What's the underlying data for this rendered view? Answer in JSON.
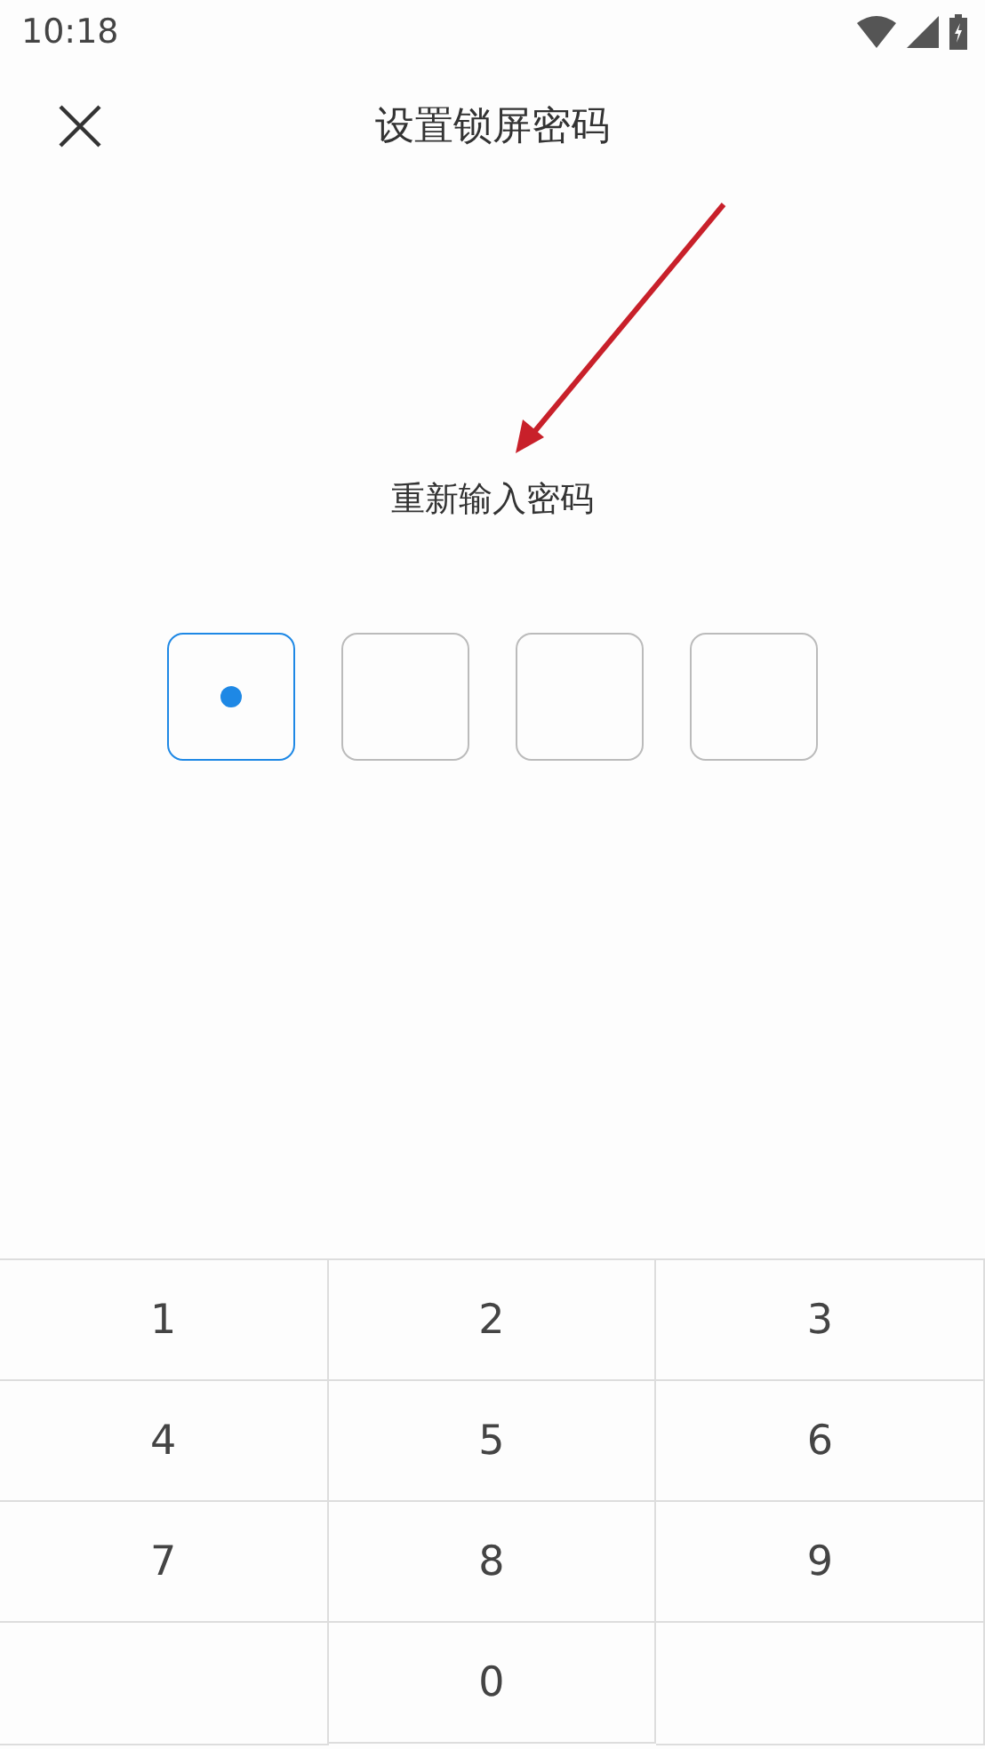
{
  "status_bar": {
    "time": "10:18"
  },
  "header": {
    "title": "设置锁屏密码"
  },
  "prompt": "重新输入密码",
  "pin_boxes": [
    {
      "filled": true,
      "focused": true
    },
    {
      "filled": false,
      "focused": false
    },
    {
      "filled": false,
      "focused": false
    },
    {
      "filled": false,
      "focused": false
    }
  ],
  "keypad": [
    {
      "kind": "digit",
      "label": "1"
    },
    {
      "kind": "digit",
      "label": "2"
    },
    {
      "kind": "digit",
      "label": "3"
    },
    {
      "kind": "digit",
      "label": "4"
    },
    {
      "kind": "digit",
      "label": "5"
    },
    {
      "kind": "digit",
      "label": "6"
    },
    {
      "kind": "digit",
      "label": "7"
    },
    {
      "kind": "digit",
      "label": "8"
    },
    {
      "kind": "digit",
      "label": "9"
    },
    {
      "kind": "blank"
    },
    {
      "kind": "digit",
      "label": "0"
    },
    {
      "kind": "blank"
    }
  ]
}
